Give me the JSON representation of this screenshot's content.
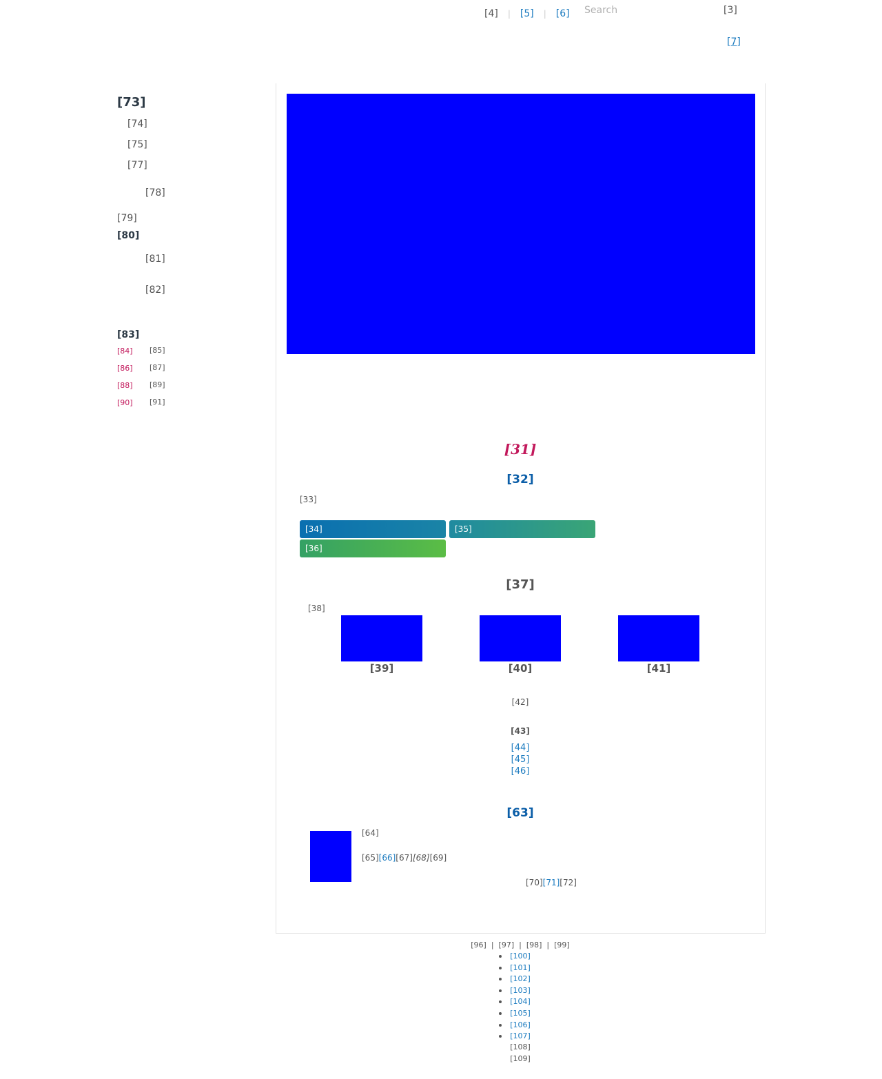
{
  "header": {
    "nav": [
      {
        "label": "[4]",
        "link": false
      },
      {
        "label": "[5]",
        "link": true
      },
      {
        "label": "[6]",
        "link": true
      }
    ],
    "search_placeholder": "Search",
    "user_label": "[3]",
    "secondary_link": "[7]"
  },
  "sidebar": {
    "title": "[73]",
    "items": [
      "[74]",
      "[75]",
      "[77]"
    ],
    "sub_item": "[78]",
    "item_79": "[79]",
    "section_80": "[80]",
    "sub_81": "[81]",
    "sub_82": "[82]",
    "section_83": "[83]",
    "pairs": [
      {
        "key": "[84]",
        "value": "[85]"
      },
      {
        "key": "[86]",
        "value": "[87]"
      },
      {
        "key": "[88]",
        "value": "[89]"
      },
      {
        "key": "[90]",
        "value": "[91]"
      }
    ]
  },
  "main": {
    "title_31": "[31]",
    "title_32": "[32]",
    "label_33": "[33]",
    "buttons": [
      "[34]",
      "[35]",
      "[36]"
    ],
    "title_37": "[37]",
    "label_38": "[38]",
    "thumbs": [
      "[39]",
      "[40]",
      "[41]"
    ],
    "label_42": "[42]",
    "heading_43": "[43]",
    "links": [
      "[44]",
      "[45]",
      "[46]"
    ],
    "title_63": "[63]",
    "media": {
      "line1": "[64]",
      "line2": {
        "a": "[65]",
        "b": "[66]",
        "c": "[67]",
        "d": "[68]",
        "e": "[69]"
      },
      "line3": {
        "a": "[70]",
        "b": "[71]",
        "c": "[72]"
      }
    }
  },
  "footer": {
    "inline": [
      "[96]",
      "[97]",
      "[98]",
      "[99]"
    ],
    "list": [
      "[100]",
      "[101]",
      "[102]",
      "[103]",
      "[104]",
      "[105]",
      "[106]",
      "[107]"
    ],
    "line_108": "[108]",
    "line_109": "[109]"
  },
  "colors": {
    "placeholder_blue": "#0000ff",
    "accent_pink": "#c2185b",
    "title_blue": "#0b5ea8",
    "link_blue": "#1a7abf"
  }
}
